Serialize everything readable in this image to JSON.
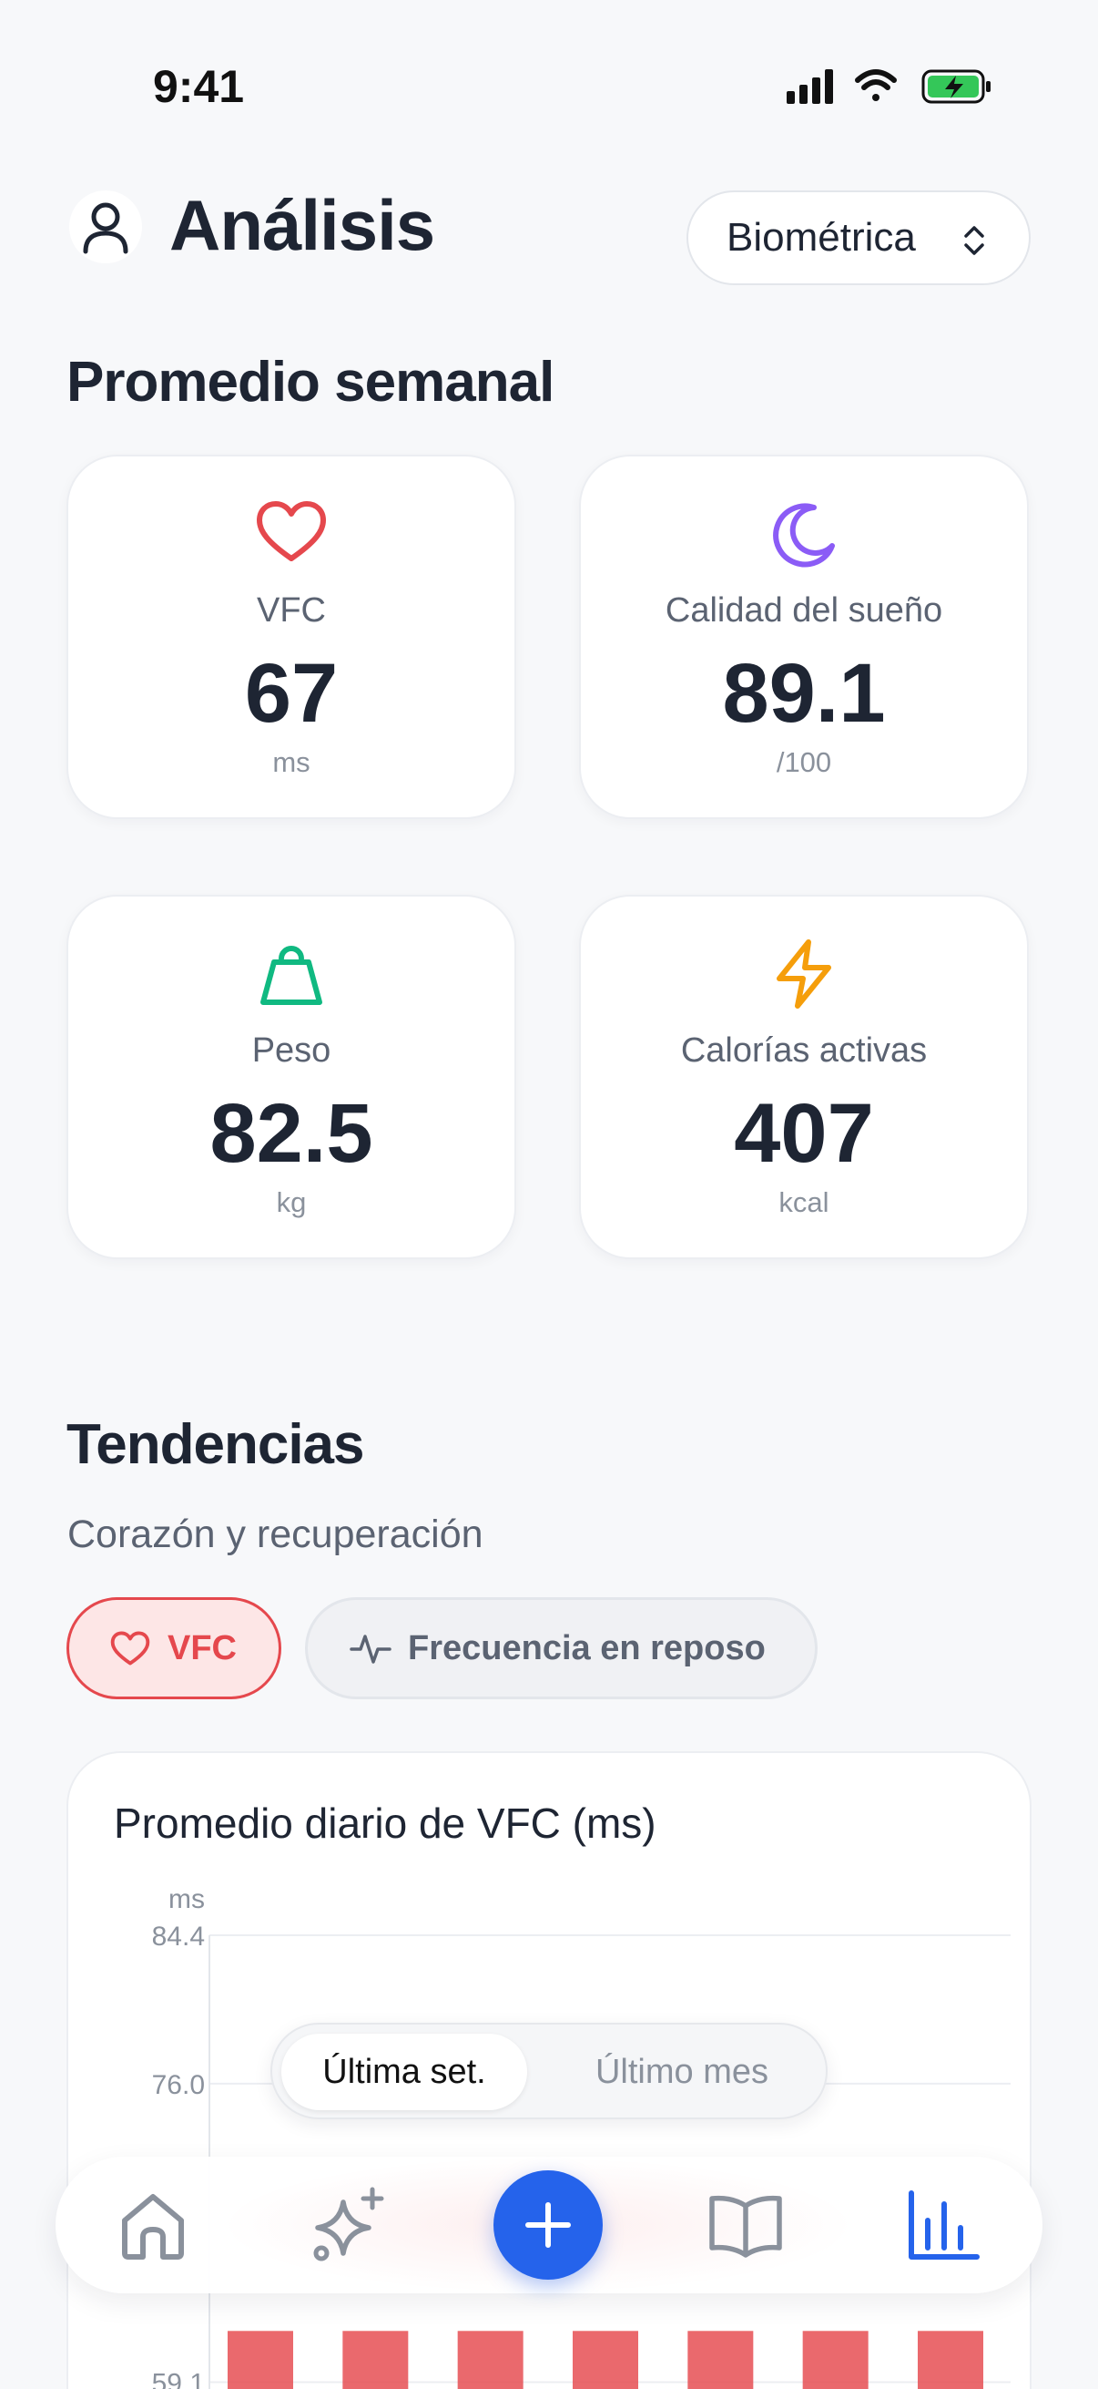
{
  "status_bar": {
    "time": "9:41"
  },
  "header": {
    "title": "Análisis",
    "filter_label": "Biométrica"
  },
  "weekly": {
    "title": "Promedio semanal",
    "cards": [
      {
        "label": "VFC",
        "value": "67",
        "unit": "ms",
        "icon": "heart-icon",
        "color": "#e5484d"
      },
      {
        "label": "Calidad del sueño",
        "value": "89.1",
        "unit": "/100",
        "icon": "moon-icon",
        "color": "#8b5cf6"
      },
      {
        "label": "Peso",
        "value": "82.5",
        "unit": "kg",
        "icon": "weight-icon",
        "color": "#10b981"
      },
      {
        "label": "Calorías activas",
        "value": "407",
        "unit": "kcal",
        "icon": "bolt-icon",
        "color": "#f59e0b"
      }
    ]
  },
  "trends": {
    "title": "Tendencias",
    "subtitle": "Corazón y recuperación",
    "chips": [
      {
        "label": "VFC",
        "icon": "heart-icon",
        "active": true
      },
      {
        "label": "Frecuencia en reposo",
        "icon": "pulse-icon",
        "active": false
      }
    ]
  },
  "chart_data": {
    "type": "bar",
    "title": "Promedio diario de VFC (ms)",
    "ylabel": "ms",
    "yticks": [
      "84.4",
      "76.0",
      "59.1"
    ],
    "ylim": [
      55,
      84.4
    ],
    "values": [
      62,
      62,
      62,
      62,
      62,
      62,
      62
    ],
    "color": "#e5484d"
  },
  "range_toggle": {
    "options": [
      "Última set.",
      "Último mes"
    ],
    "selected": "Última set."
  },
  "tab_bar": {
    "items": [
      "home-icon",
      "sparkle-icon",
      "add-icon",
      "book-icon",
      "chart-icon"
    ],
    "active": "chart-icon",
    "accent": "#2563eb"
  }
}
